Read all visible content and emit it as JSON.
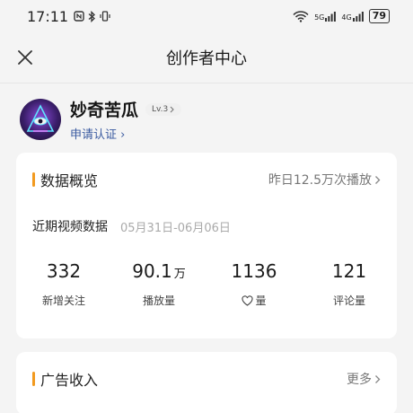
{
  "status_bar": {
    "time": "17:11",
    "left_icons": "N ✱ ▯",
    "network_1": "5G",
    "network_2": "4G",
    "battery": "79"
  },
  "nav": {
    "title": "创作者中心"
  },
  "profile": {
    "name": "妙奇苦瓜",
    "level": "Lv.3",
    "verify_link": "申请认证 ›"
  },
  "data_overview": {
    "title": "数据概览",
    "summary_link": "昨日12.5万次播放",
    "period_label": "近期视频数据",
    "period_range": "05月31日-06月06日",
    "stats": [
      {
        "value": "332",
        "unit": "",
        "label": "新增关注"
      },
      {
        "value": "90.1",
        "unit": "万",
        "label": "播放量"
      },
      {
        "value": "1136",
        "unit": "",
        "label": "量",
        "icon": "heart-icon"
      },
      {
        "value": "121",
        "unit": "",
        "label": "评论量"
      }
    ]
  },
  "ad_income": {
    "title": "广告收入",
    "more_link": "更多"
  },
  "colors": {
    "accent": "#f29a1f",
    "verify_link": "#3a5aa0",
    "background": "#f4f4f4"
  }
}
